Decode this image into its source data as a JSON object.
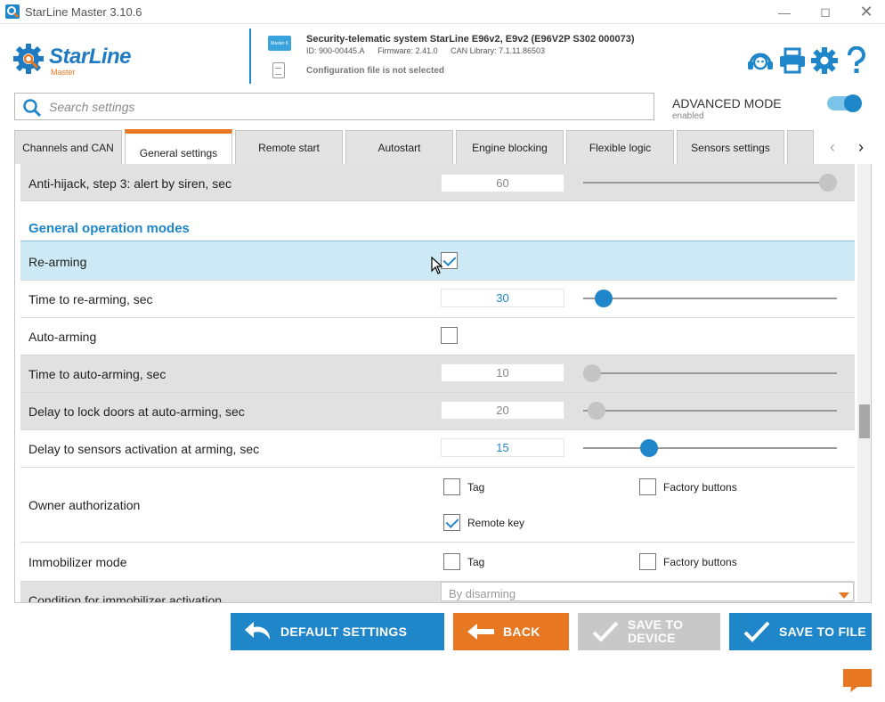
{
  "window": {
    "title": "StarLine Master 3.10.6"
  },
  "header": {
    "brand": "StarLine",
    "brand_sub": "Master",
    "device_tag": "Master 6",
    "system_title": "Security-telematic system StarLine E96v2, E9v2 (E96V2P S302 000073)",
    "id": "ID: 900-00445.A",
    "firmware": "Firmware: 2.41.0",
    "can_library": "CAN Library: 7.1.11.86503",
    "config_status": "Configuration file is not selected"
  },
  "search": {
    "placeholder": "Search settings"
  },
  "mode": {
    "label": "ADVANCED MODE",
    "status": "enabled",
    "on": true
  },
  "tabs": [
    {
      "label": "Channels and CAN"
    },
    {
      "label": "General settings",
      "active": true
    },
    {
      "label": "Remote start"
    },
    {
      "label": "Autostart"
    },
    {
      "label": "Engine blocking"
    },
    {
      "label": "Flexible logic"
    },
    {
      "label": "Sensors settings"
    }
  ],
  "settings": {
    "anti_hijack": {
      "label": "Anti-hijack, step 3: alert by siren, sec",
      "value": "60",
      "level": 1.0
    },
    "section_title": "General operation modes",
    "re_arming": {
      "label": "Re-arming",
      "checked": true
    },
    "time_re_arming": {
      "label": "Time to re-arming, sec",
      "value": "30",
      "level": 0.05
    },
    "auto_arming": {
      "label": "Auto-arming",
      "checked": false
    },
    "time_auto_arming": {
      "label": "Time to auto-arming, sec",
      "value": "10",
      "level": 0.0
    },
    "delay_lock_doors": {
      "label": "Delay to lock doors at auto-arming, sec",
      "value": "20",
      "level": 0.02
    },
    "delay_sensors": {
      "label": "Delay to sensors activation at arming, sec",
      "value": "15",
      "level": 0.24
    },
    "owner_authorization": {
      "label": "Owner authorization",
      "options": [
        {
          "label": "Tag",
          "checked": false
        },
        {
          "label": "Factory buttons",
          "checked": false
        },
        {
          "label": "Remote key",
          "checked": true
        }
      ]
    },
    "immobilizer_mode": {
      "label": "Immobilizer mode",
      "options": [
        {
          "label": "Tag",
          "checked": false
        },
        {
          "label": "Factory buttons",
          "checked": false
        }
      ]
    },
    "immobilizer_condition": {
      "label": "Condition for immobilizer activation",
      "value": "By disarming"
    }
  },
  "buttons": {
    "default_settings": "DEFAULT SETTINGS",
    "back": "BACK",
    "save_to_device_1": "SAVE TO",
    "save_to_device_2": "DEVICE",
    "save_to_file": "SAVE TO FILE"
  },
  "colors": {
    "accent_blue": "#1f86c9",
    "accent_orange": "#e87722",
    "highlight": "#cde9f5",
    "disabled": "#c8c8c8"
  },
  "icons": [
    "support-icon",
    "printer-icon",
    "gear-icon",
    "help-icon",
    "search-icon",
    "chat-icon"
  ]
}
